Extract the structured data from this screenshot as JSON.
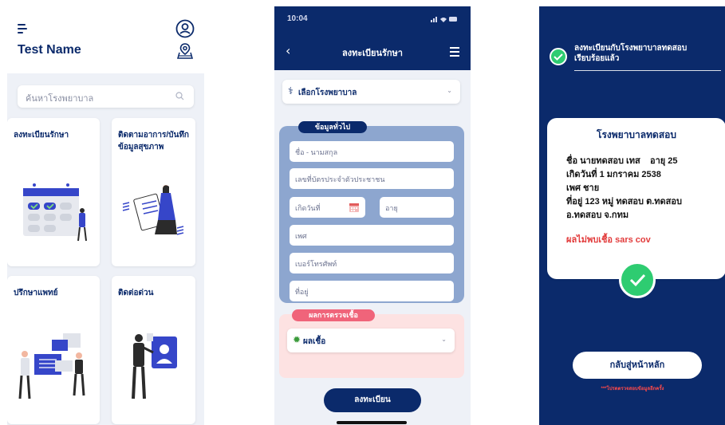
{
  "screen1": {
    "user_name": "Test Name",
    "search_placeholder": "ค้นหาโรงพยาบาล",
    "cards": [
      {
        "label": "ลงทะเบียนรักษา"
      },
      {
        "label": "ติดตามอาการ/บันทึกข้อมูลสุขภาพ"
      },
      {
        "label": "ปรึกษาแพทย์"
      },
      {
        "label": "ติดต่อด่วน"
      }
    ]
  },
  "screen2": {
    "status_time": "10:04",
    "title": "ลงทะเบียนรักษา",
    "hospital_select": "เลือกโรงพยาบาล",
    "general_section": "ข้อมูลทั่วไป",
    "fields": {
      "name": "ชื่อ - นามสกุล",
      "id_card": "เลขที่บัตรประจำตัวประชาชน",
      "birthdate": "เกิดวันที่",
      "age": "อายุ",
      "gender": "เพศ",
      "phone": "เบอร์โทรศัพท์",
      "address": "ที่อยู่"
    },
    "result_section": "ผลการตรวจเชื้อ",
    "result_select": "ผลเชื้อ",
    "register_button": "ลงทะเบียน"
  },
  "screen3": {
    "success_line1": "ลงทะเบียนกับโรงพยาบาลทดสอบ",
    "success_line2": "เรียบร้อยแล้ว",
    "hospital_name": "โรงพยาบาลทดสอบ",
    "info_lines": [
      "ชื่อ นายทดสอบ เทส    อายุ 25",
      "เกิดวันที่ 1 มกราคม 2538",
      "เพศ ชาย",
      "ที่อยู่ 123 หมู่ ทดสอบ ต.ทดสอบ",
      "อ.ทดสอบ จ.กทม"
    ],
    "result_text": "ผลไม่พบเชื้อ sars cov",
    "home_button": "กลับสู่หน้าหลัก",
    "note": "***โปรดตรวจสอบข้อมูลอีกครั้ง"
  },
  "colors": {
    "navy": "#0b2a6b",
    "light_bg": "#eef1f7",
    "form_blue": "#8da6cf",
    "result_pink": "#fde2e2",
    "result_pill": "#f0647a",
    "success_green": "#2ecc71",
    "negative_red": "#e23b3b"
  }
}
